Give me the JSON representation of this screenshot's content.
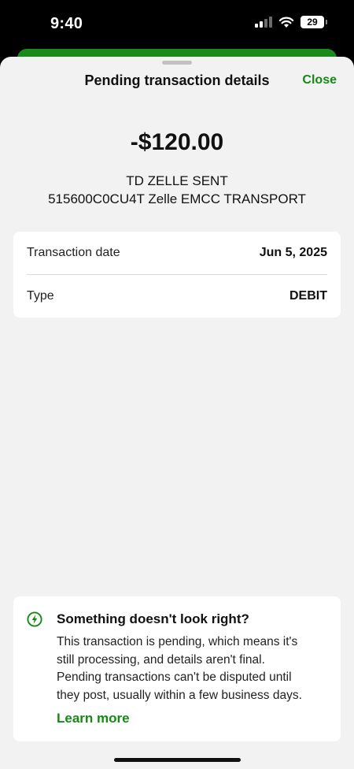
{
  "status_bar": {
    "time": "9:40",
    "battery": "29",
    "icons": [
      "cellular-signal-icon",
      "wifi-icon",
      "battery-icon"
    ]
  },
  "sheet": {
    "title": "Pending transaction details",
    "close_label": "Close"
  },
  "transaction": {
    "amount": "-$120.00",
    "merchant_line1": "TD ZELLE SENT",
    "merchant_line2": "515600C0CU4T Zelle EMCC TRANSPORT"
  },
  "details": [
    {
      "label": "Transaction date",
      "value": "Jun 5, 2025"
    },
    {
      "label": "Type",
      "value": "DEBIT"
    }
  ],
  "notice": {
    "icon": "lightning-circle-icon",
    "title": "Something doesn't look right?",
    "body_lines": [
      "This transaction is pending, which means it's",
      "still processing, and details aren't final.",
      "Pending transactions can't be disputed until",
      "they post, usually within a few business days."
    ],
    "link_label": "Learn more"
  },
  "colors": {
    "accent_green": "#148a14",
    "sheet_background": "#f2f2f2",
    "card_background": "#ffffff"
  }
}
